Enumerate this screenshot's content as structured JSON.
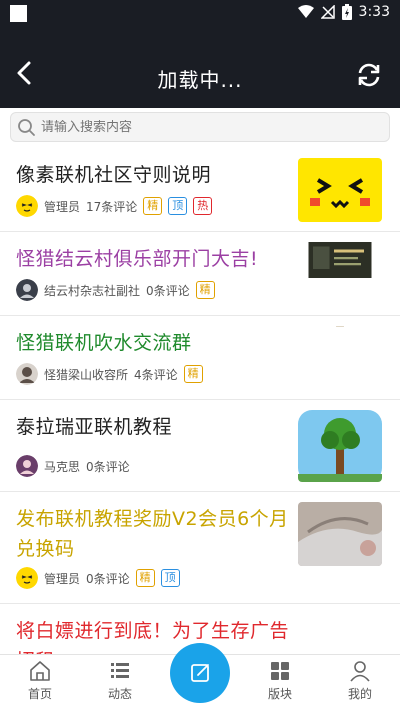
{
  "status": {
    "time": "3:33"
  },
  "header": {
    "title": "加载中..."
  },
  "search": {
    "placeholder": "请输入搜索内容"
  },
  "colors": {
    "accent": "#1aa3e9",
    "header_bg": "#1a1d24"
  },
  "posts": [
    {
      "title": "像素联机社区守则说明",
      "title_color": "#222222",
      "author": "管理员",
      "comments": "17条评论",
      "badges": [
        "精",
        "顶",
        "热"
      ]
    },
    {
      "title": "怪猎结云村俱乐部开门大吉!",
      "title_color": "#9b3fa3",
      "author": "结云村杂志社副社",
      "comments": "0条评论",
      "badges": [
        "精"
      ]
    },
    {
      "title": "怪猎联机吹水交流群",
      "title_color": "#1f8a2c",
      "author": "怪猎梁山收容所",
      "comments": "4条评论",
      "badges": [
        "精"
      ]
    },
    {
      "title": "泰拉瑞亚联机教程",
      "title_color": "#222222",
      "author": "马克思",
      "comments": "0条评论",
      "badges": []
    },
    {
      "title": "发布联机教程奖励V2会员6个月兑换码",
      "title_color": "#c8a400",
      "author": "管理员",
      "comments": "0条评论",
      "badges": [
        "精",
        "顶"
      ]
    },
    {
      "title": "将白嫖进行到底！为了生存广告招租",
      "title_color": "#e0282d",
      "author": "",
      "comments": "",
      "badges": []
    }
  ],
  "nav": {
    "home": "首页",
    "feed": "动态",
    "boards": "版块",
    "mine": "我的"
  }
}
